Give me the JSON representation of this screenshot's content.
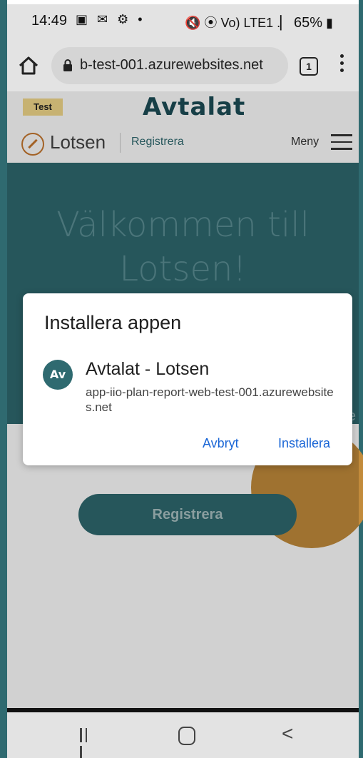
{
  "status_bar": {
    "time": "14:49",
    "left_icons": "▣ ✉ ⚙ •",
    "right_icons": "🔇 ⦿ Vo) LTE1 .▏",
    "battery": "65%"
  },
  "browser": {
    "url": "b-test-001.azurewebsites.net",
    "tab_count": "1"
  },
  "page": {
    "test_badge": "Test",
    "brand": "Avtalat",
    "nav_title": "Lotsen",
    "nav_register": "Registrera",
    "nav_menu": "Meny",
    "hero_title": "Välkommen till Lotsen!",
    "edge_text": "e",
    "register_button": "Registrera"
  },
  "dialog": {
    "title": "Installera appen",
    "app_icon_text": "Av",
    "app_name": "Avtalat - Lotsen",
    "app_url": "app-iio-plan-report-web-test-001.azurewebsites.net",
    "cancel": "Avbryt",
    "install": "Installera"
  },
  "nav_bar": {
    "back_glyph": "<"
  }
}
